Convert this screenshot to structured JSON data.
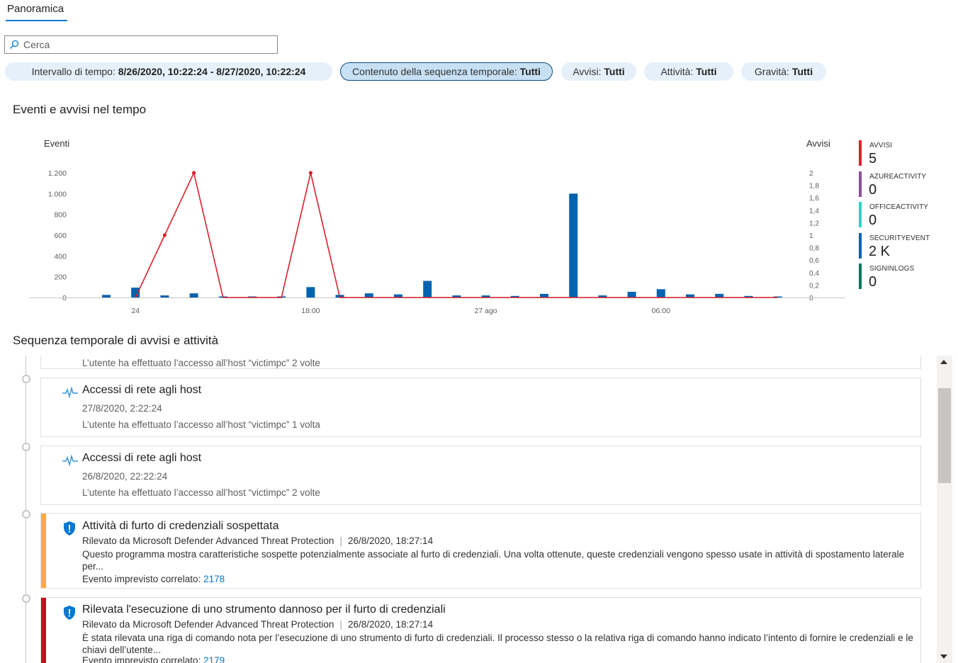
{
  "tabs": [
    {
      "label": "Panoramica",
      "active": true
    }
  ],
  "search": {
    "placeholder": "Cerca"
  },
  "filters": [
    {
      "label": "Intervallo di tempo: ",
      "value": "8/26/2020, 10:22:24 - 8/27/2020, 10:22:24",
      "active": false
    },
    {
      "label": "Contenuto della sequenza temporale: ",
      "value": "Tutti",
      "active": true
    },
    {
      "label": "Avvisi: ",
      "value": "Tutti",
      "active": false
    },
    {
      "label": "Attività: ",
      "value": "Tutti",
      "active": false
    },
    {
      "label": "Gravità: ",
      "value": "Tutti",
      "active": false
    }
  ],
  "chart_section": {
    "title": "Eventi e avvisi nel tempo"
  },
  "chart_data": {
    "type": "bar",
    "ylabel": "Eventi",
    "y2label": "Avvisi",
    "ylim": [
      0,
      1200
    ],
    "y2lim": [
      0,
      2
    ],
    "yticks": [
      "0",
      "200",
      "400",
      "600",
      "800",
      "1.000",
      "1.200"
    ],
    "y2ticks": [
      "0",
      "0,2",
      "0,4",
      "0,6",
      "0,8",
      "1",
      "1,2",
      "1,4",
      "1,6",
      "1,8",
      "2"
    ],
    "xticks": [
      {
        "label": "24",
        "index": 1
      },
      {
        "label": "18:00",
        "index": 7
      },
      {
        "label": "27 ago",
        "index": 13
      },
      {
        "label": "06:00",
        "index": 19
      }
    ],
    "bar_count": 24,
    "series": [
      {
        "name": "SECURITYEVENT",
        "kind": "bar",
        "color": "#0063b1",
        "values": [
          25,
          95,
          20,
          40,
          5,
          5,
          5,
          100,
          25,
          40,
          30,
          160,
          20,
          20,
          15,
          35,
          1000,
          20,
          55,
          80,
          30,
          35,
          15,
          5
        ]
      },
      {
        "name": "AVVISI",
        "kind": "line",
        "color": "#d9212c",
        "points": [
          [
            1,
            0
          ],
          [
            2,
            1
          ],
          [
            3,
            2
          ],
          [
            4,
            0
          ],
          [
            5,
            0
          ],
          [
            6,
            0
          ],
          [
            7,
            2
          ],
          [
            8,
            0
          ],
          [
            9,
            0
          ],
          [
            10,
            0
          ],
          [
            11,
            0
          ],
          [
            12,
            0
          ],
          [
            13,
            0
          ],
          [
            14,
            0
          ],
          [
            15,
            0
          ],
          [
            16,
            0
          ],
          [
            17,
            0
          ],
          [
            18,
            0
          ],
          [
            19,
            0
          ],
          [
            20,
            0
          ],
          [
            21,
            0
          ],
          [
            22,
            0
          ],
          [
            23,
            0
          ]
        ],
        "markers": [
          2,
          3,
          7
        ]
      }
    ]
  },
  "legend": [
    {
      "name": "AVVISI",
      "value": "5",
      "color": "#d9212c"
    },
    {
      "name": "AZUREACTIVITY",
      "value": "0",
      "color": "#8e4f97"
    },
    {
      "name": "OFFICEACTIVITY",
      "value": "0",
      "color": "#27d6c4"
    },
    {
      "name": "SECURITYEVENT",
      "value": "2 K",
      "color": "#0063b1"
    },
    {
      "name": "SIGNINLOGS",
      "value": "0",
      "color": "#00785a"
    }
  ],
  "timeline_section": {
    "title": "Sequenza temporale di avvisi e attività"
  },
  "timeline": {
    "partial_item": {
      "description": "L’utente ha effettuato l’accesso all’host “victimpc” 2 volte"
    },
    "items": [
      {
        "type": "activity",
        "title": "Accessi di rete agli host",
        "timestamp": "27/8/2020, 2:22:24",
        "description": "L’utente ha effettuato l’accesso all’host “victimpc” 1 volta",
        "icon": "network-activity-icon"
      },
      {
        "type": "activity",
        "title": "Accessi di rete agli host",
        "timestamp": "26/8/2020, 22:22:24",
        "description": "L’utente ha effettuato l’accesso all’host “victimpc” 2 volte",
        "icon": "network-activity-icon"
      },
      {
        "type": "alert",
        "severity_color": "#ffaa44",
        "title": "Attività di furto di credenziali sospettata",
        "source": "Rilevato da Microsoft Defender Advanced Threat Protection",
        "timestamp": "26/8/2020, 18:27:14",
        "description": "Questo programma mostra caratteristiche sospette potenzialmente associate al furto di credenziali. Una volta ottenute, queste credenziali vengono spesso usate in attività di spostamento laterale per...",
        "correlated_label": "Evento imprevisto correlato: ",
        "correlated_id": "2178",
        "icon": "shield-alert-icon"
      },
      {
        "type": "alert",
        "severity_color": "#c50f1f",
        "title": "Rilevata l'esecuzione di uno strumento dannoso per il furto di credenziali",
        "source": "Rilevato da Microsoft Defender Advanced Threat Protection",
        "timestamp": "26/8/2020, 18:27:14",
        "description": "È stata rilevata una riga di comando nota per l’esecuzione di uno strumento di furto di credenziali. Il processo stesso o la relativa riga di comando hanno indicato l’intento di fornire le credenziali e le chiavi dell’utente...",
        "correlated_label": "Evento imprevisto correlato: ",
        "correlated_id": "2179",
        "icon": "shield-alert-icon"
      }
    ]
  }
}
